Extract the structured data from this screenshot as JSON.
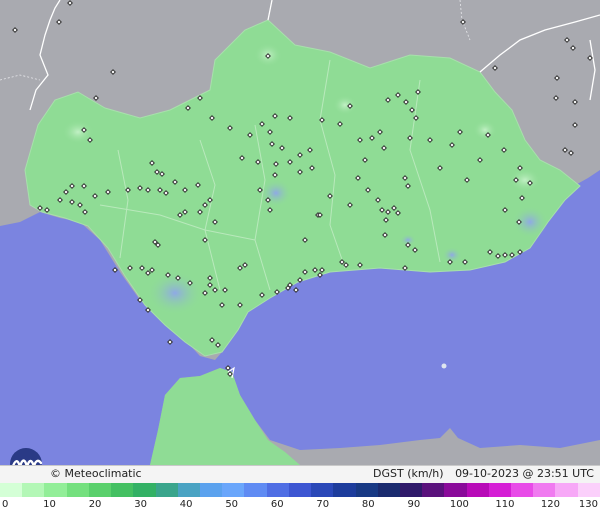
{
  "footer": {
    "credit": "© Meteoclimatic",
    "variable": "DGST (km/h)",
    "datetime": "09-10-2023 @ 23:51 UTC"
  },
  "scale": {
    "ticks": [
      "0",
      "10",
      "20",
      "30",
      "40",
      "50",
      "60",
      "70",
      "80",
      "90",
      "100",
      "110",
      "120",
      "130"
    ],
    "colors": [
      "#d4ffd6",
      "#b3f7b6",
      "#92ee98",
      "#74e07e",
      "#5ad06c",
      "#44c062",
      "#33b165",
      "#3aa58c",
      "#4aa3c3",
      "#5ba2ee",
      "#6aa6fb",
      "#5f8bf3",
      "#4f6ee4",
      "#3d56d2",
      "#2a48b8",
      "#1d3c9c",
      "#183984",
      "#1a2a6e",
      "#2f1a6a",
      "#5a117c",
      "#8a0a9a",
      "#b80ab8",
      "#d51ed5",
      "#e84be8",
      "#f07af0",
      "#f7a8f7",
      "#fbd0fb"
    ]
  },
  "colors": {
    "sea": "#7b84e0",
    "land_other": "#a9aab0",
    "andalusia": "#8fdc95",
    "north_africa": "#8fdc95"
  },
  "icons": {
    "logo": "meteoclimatic-logo-icon",
    "station": "station-marker-icon"
  }
}
